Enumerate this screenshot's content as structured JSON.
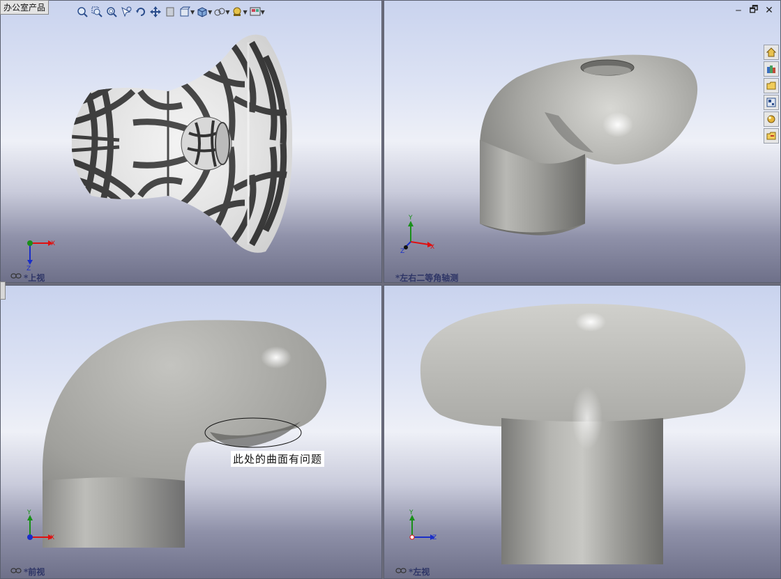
{
  "app": {
    "office_label": "办公室产品"
  },
  "toolbar": {
    "items": [
      {
        "icon": "zoom-to-fit-icon",
        "dropdown": false
      },
      {
        "icon": "zoom-to-area-icon",
        "dropdown": false
      },
      {
        "icon": "zoom-in-out-icon",
        "dropdown": false
      },
      {
        "icon": "zoom-to-selection-icon",
        "dropdown": false
      },
      {
        "icon": "rotate-view-icon",
        "dropdown": false
      },
      {
        "icon": "pan-icon",
        "dropdown": false
      },
      {
        "icon": "previous-view-icon",
        "dropdown": false
      },
      {
        "icon": "section-view-icon",
        "dropdown": true
      },
      {
        "icon": "view-orientation-icon",
        "dropdown": true
      },
      {
        "icon": "display-style-icon",
        "dropdown": true
      },
      {
        "icon": "hide-show-items-icon",
        "dropdown": true
      },
      {
        "icon": "edit-appearance-icon",
        "dropdown": true
      }
    ]
  },
  "window_controls": {
    "minimize": "‒",
    "restore": "🗗",
    "close": "✕"
  },
  "taskpane": {
    "items": [
      {
        "icon": "home-icon"
      },
      {
        "icon": "design-library-icon"
      },
      {
        "icon": "file-explorer-icon"
      },
      {
        "icon": "view-palette-icon"
      },
      {
        "icon": "appearances-icon"
      },
      {
        "icon": "custom-properties-icon"
      }
    ]
  },
  "viewports": {
    "top": {
      "label": "*上视",
      "triad": [
        "X",
        "Z"
      ]
    },
    "iso": {
      "label": "*左右二等角轴测",
      "triad": [
        "Y",
        "X",
        "Z"
      ]
    },
    "front": {
      "label": "*前视",
      "triad": [
        "Y",
        "X"
      ]
    },
    "left": {
      "label": "*左视",
      "triad": [
        "Y",
        "Z"
      ]
    }
  },
  "annotation": {
    "text": "此处的曲面有问题"
  },
  "colors": {
    "axis_x": "#e01010",
    "axis_y": "#1a8f1a",
    "axis_z": "#1a2ec8",
    "label": "#2e3566"
  }
}
